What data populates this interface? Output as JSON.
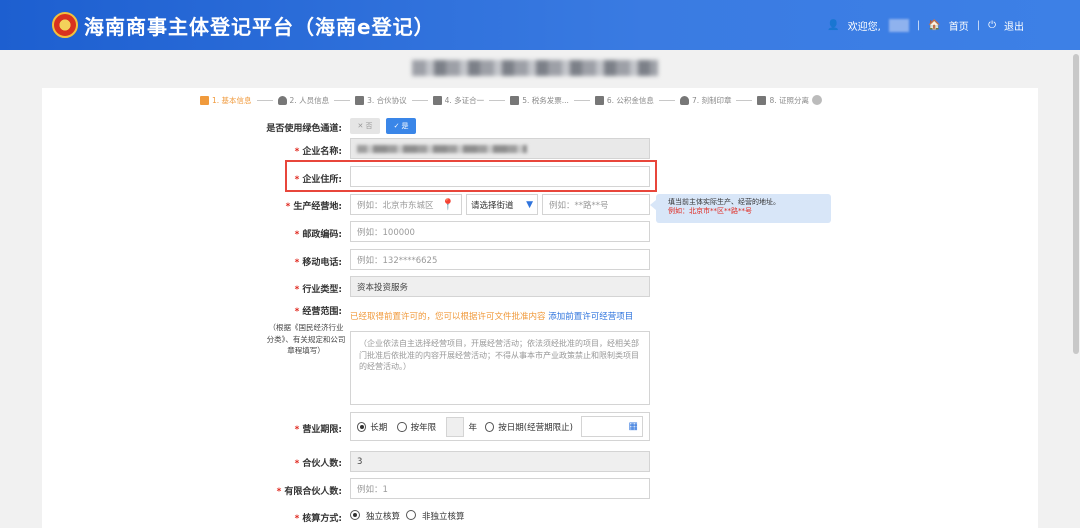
{
  "header": {
    "app_title": "海南商事主体登记平台（海南e登记）",
    "welcome": "欢迎您,",
    "home": "首页",
    "logout": "退出",
    "brand_color": "#2f6fe0"
  },
  "steps": [
    {
      "label": "1. 基本信息",
      "icon": "chart-icon"
    },
    {
      "label": "2. 人员信息",
      "icon": "person-icon"
    },
    {
      "label": "3. 合伙协议",
      "icon": "document-icon"
    },
    {
      "label": "4. 多证合一",
      "icon": "certificate-icon"
    },
    {
      "label": "5. 税务发票...",
      "icon": "invoice-icon"
    },
    {
      "label": "6. 公积金信息",
      "icon": "fund-icon"
    },
    {
      "label": "7. 刻制印章",
      "icon": "stamp-icon"
    },
    {
      "label": "8. 证照分离",
      "icon": "license-icon"
    }
  ],
  "form": {
    "green_channel": {
      "label": "是否使用绿色通道:",
      "off": "否",
      "on": "是"
    },
    "company_name": {
      "label": "企业名称:"
    },
    "company_address": {
      "label": "企业住所:",
      "value": ""
    },
    "production_address": {
      "label": "生产经营地:",
      "placeholder": "例如：北京市东城区",
      "street_select": "请选择街道",
      "detail_placeholder": "例如：**路**号"
    },
    "tooltip": {
      "line1": "填当前主体实际生产、经营的地址。",
      "line2": "例如：北京市**区**路**号"
    },
    "postal_code": {
      "label": "邮政编码:",
      "placeholder": "例如：100000"
    },
    "mobile": {
      "label": "移动电话:",
      "placeholder": "例如：132****6625"
    },
    "industry": {
      "label": "行业类型:",
      "value": "资本投资服务"
    },
    "business_scope": {
      "label": "经营范围:",
      "notice_orange": "已经取得前置许可的，您可以根据许可文件批准内容",
      "notice_link": "添加前置许可经营项目",
      "side_note": "（根据《国民经济行业分类》、有关规定和公司章程填写）",
      "placeholder": "（企业依法自主选择经营项目，开展经营活动；依法须经批准的项目，经相关部门批准后依批准的内容开展经营活动；不得从事本市产业政策禁止和限制类项目的经营活动。）"
    },
    "business_term": {
      "label": "营业期限:",
      "long_term": "长期",
      "by_years": "按年限",
      "year_unit": "年",
      "by_date": "按日期(经营期限止)"
    },
    "partner_count": {
      "label": "合伙人数:",
      "value": "3"
    },
    "limited_partner_count": {
      "label": "有限合伙人数:",
      "placeholder": "例如：1"
    },
    "accounting": {
      "label": "核算方式:",
      "option1": "独立核算",
      "option2": "非独立核算"
    }
  }
}
